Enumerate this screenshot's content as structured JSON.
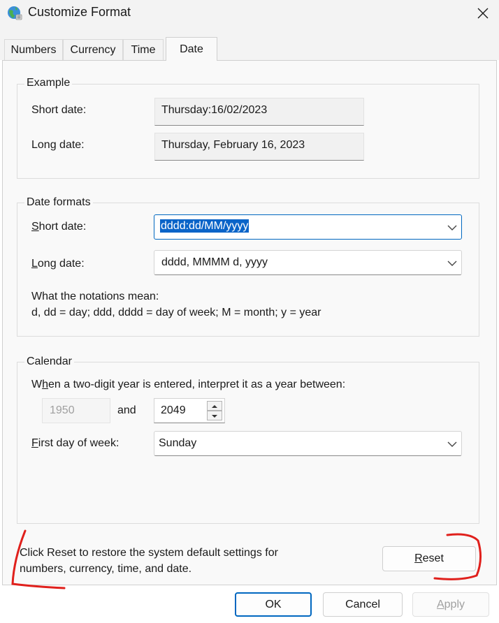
{
  "window": {
    "title": "Customize Format",
    "icon": "globe-settings-icon",
    "close_icon": "close-icon"
  },
  "tabs": [
    {
      "label": "Numbers",
      "active": false
    },
    {
      "label": "Currency",
      "active": false
    },
    {
      "label": "Time",
      "active": false
    },
    {
      "label": "Date",
      "active": true
    }
  ],
  "example": {
    "legend": "Example",
    "short_label": "Short date:",
    "short_value": "Thursday:16/02/2023",
    "long_label": "Long date:",
    "long_value": "Thursday, February 16, 2023"
  },
  "formats": {
    "legend": "Date formats",
    "short_label_key": "S",
    "short_label_rest": "hort date:",
    "short_value": "dddd:dd/MM/yyyy",
    "long_label_key": "L",
    "long_label_rest": "ong date:",
    "long_value": "dddd, MMMM d, yyyy",
    "notation_title": "What the notations mean:",
    "notation_text": "d, dd = day;  ddd, dddd = day of week;  M = month;  y = year"
  },
  "calendar": {
    "legend": "Calendar",
    "twodigit_pre": "W",
    "twodigit_key": "h",
    "twodigit_post": "en a two-digit year is entered, interpret it as a year between:",
    "year_from": "1950",
    "and_label": "and",
    "year_to": "2049",
    "firstday_key": "F",
    "firstday_rest": "irst day of week:",
    "firstday_value": "Sunday"
  },
  "reset": {
    "text_line1": "Click Reset to restore the system default settings for",
    "text_line2": "numbers, currency, time, and date.",
    "button_key": "R",
    "button_rest": "eset"
  },
  "buttons": {
    "ok": "OK",
    "cancel": "Cancel",
    "apply_key": "A",
    "apply_rest": "pply"
  },
  "colors": {
    "accent": "#0067c0",
    "selection": "#0a64c8",
    "annotation": "#e0201c"
  }
}
